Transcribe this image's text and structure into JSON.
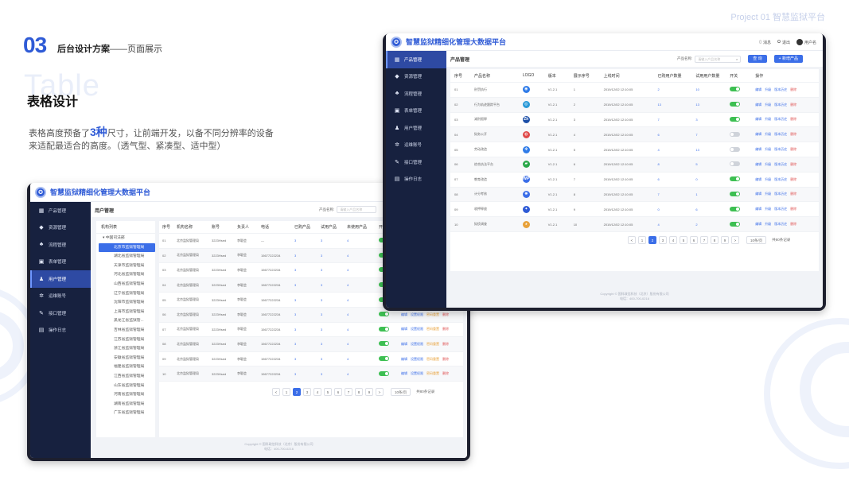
{
  "header": {
    "project_label": "Project 01  智慧监狱平台"
  },
  "section": {
    "number": "03",
    "title": "后台设计方案",
    "subtitle": "——页面展示"
  },
  "ghost_word": "Table",
  "heading": "表格设计",
  "description": {
    "before": "表格高度预备了",
    "highlight": "3种",
    "after": "尺寸，让前端开发，以备不同分辨率的设备来适配最适合的高度。（透气型、紧凑型、适中型）"
  },
  "app": {
    "title": "智慧监狱精细化管理大数据平台",
    "tools": {
      "message": "消息",
      "logout": "退出",
      "user": "用户名"
    },
    "sidebar": [
      {
        "icon": "grid-icon",
        "glyph": "▦",
        "label": "产品管理"
      },
      {
        "icon": "resource-icon",
        "glyph": "◆",
        "label": "资源管理"
      },
      {
        "icon": "flow-icon",
        "glyph": "♣",
        "label": "流程管理"
      },
      {
        "icon": "form-icon",
        "glyph": "▣",
        "label": "表单管理"
      },
      {
        "icon": "users-icon",
        "glyph": "♟",
        "label": "用户管理"
      },
      {
        "icon": "gear-icon",
        "glyph": "✲",
        "label": "运维账号"
      },
      {
        "icon": "plug-icon",
        "glyph": "✎",
        "label": "接口管理"
      },
      {
        "icon": "log-icon",
        "glyph": "▤",
        "label": "操作日志"
      }
    ],
    "footer": {
      "line1": "Copyright © 国科政信科技（北京）股份有限公司",
      "line2": "电话：400-700-0216"
    },
    "pager": {
      "prev": "<",
      "next": ">",
      "pages": [
        "1",
        "2",
        "3",
        "4",
        "5",
        "6",
        "7",
        "8",
        "9"
      ],
      "current_index": 1,
      "page_size": "10条/页",
      "total": "共80条记录"
    }
  },
  "user_page": {
    "active_sidebar": 4,
    "title": "用户管理",
    "filter_label": "产品名称:",
    "filter_placeholder": "请输入产品名称",
    "tree": {
      "header": "机构列表",
      "root": "中国司法部",
      "items": [
        "北京市监狱管理局",
        "湖北省监狱管理局",
        "天津市监狱管理局",
        "河北省监狱管理局",
        "山西省监狱管理局",
        "辽宁省监狱管理局",
        "沈阳市监狱管理局",
        "上海市监狱管理局",
        "黑龙江省监狱管...",
        "吉林省监狱管理局",
        "江苏省监狱管理局",
        "浙江省监狱管理局",
        "安徽省监狱管理局",
        "福建省监狱管理局",
        "江西省监狱管理局",
        "山东省监狱管理局",
        "河南省监狱管理局",
        "湖南省监狱管理局",
        "广东省监狱管理局"
      ],
      "selected": 0
    },
    "columns": [
      "序号",
      "机构名称",
      "账号",
      "负责人",
      "电话",
      "已购产品",
      "试用产品",
      "未使用产品",
      "开关",
      "操作"
    ],
    "ops": [
      "编辑",
      "设置权限",
      "密码重置",
      "删除"
    ],
    "rows": [
      {
        "no": "01",
        "org": "北京监狱管理局",
        "acct": "3223Hsed",
        "owner": "李聪会",
        "phone": "—",
        "bought": "3",
        "trial": "3",
        "unused": "4",
        "on": true
      },
      {
        "no": "02",
        "org": "北京监狱管理局",
        "acct": "3223Hsed",
        "owner": "李聪会",
        "phone": "15677222234",
        "bought": "3",
        "trial": "3",
        "unused": "4",
        "on": true
      },
      {
        "no": "03",
        "org": "北京监狱管理局",
        "acct": "3223Hsed",
        "owner": "李聪会",
        "phone": "15677222234",
        "bought": "3",
        "trial": "3",
        "unused": "4",
        "on": true
      },
      {
        "no": "04",
        "org": "北京监狱管理局",
        "acct": "3223Hsed",
        "owner": "李聪会",
        "phone": "15677222234",
        "bought": "3",
        "trial": "3",
        "unused": "4",
        "on": true
      },
      {
        "no": "05",
        "org": "北京监狱管理局",
        "acct": "3223Hsed",
        "owner": "李聪会",
        "phone": "15677222234",
        "bought": "3",
        "trial": "3",
        "unused": "4",
        "on": true
      },
      {
        "no": "06",
        "org": "北京监狱管理局",
        "acct": "3223Hsed",
        "owner": "李聪会",
        "phone": "15677222234",
        "bought": "3",
        "trial": "3",
        "unused": "4",
        "on": true
      },
      {
        "no": "07",
        "org": "北京监狱管理局",
        "acct": "3223Hsed",
        "owner": "李聪会",
        "phone": "15677222234",
        "bought": "3",
        "trial": "3",
        "unused": "4",
        "on": true
      },
      {
        "no": "08",
        "org": "北京监狱管理局",
        "acct": "3223Hsed",
        "owner": "李聪会",
        "phone": "15677222234",
        "bought": "3",
        "trial": "3",
        "unused": "4",
        "on": true
      },
      {
        "no": "09",
        "org": "北京监狱管理局",
        "acct": "3223Hsed",
        "owner": "李聪会",
        "phone": "15677222234",
        "bought": "3",
        "trial": "3",
        "unused": "4",
        "on": true
      },
      {
        "no": "10",
        "org": "北京监狱管理局",
        "acct": "3223Hsed",
        "owner": "李聪会",
        "phone": "15677222234",
        "bought": "3",
        "trial": "3",
        "unused": "4",
        "on": true
      }
    ]
  },
  "product_page": {
    "active_sidebar": 0,
    "title": "产品管理",
    "filter_label": "产品名称:",
    "filter_placeholder": "请输入产品名称",
    "query_button": "查 询",
    "add_button": "+ 新增产品",
    "columns": [
      "序号",
      "产品名称",
      "LOGO",
      "版本",
      "展示序号",
      "上线时间",
      "已购用户数量",
      "试用用户数量",
      "开关",
      "操作"
    ],
    "ops": [
      "编辑",
      "升级",
      "版本历史",
      "删除"
    ],
    "rows": [
      {
        "no": "01",
        "name": "刑罚执行",
        "logo": "cloud-logo",
        "color": "#2f7be8",
        "glyph": "◉",
        "ver": "V1.2.1",
        "order": "1",
        "time": "2019/12/02  12:10:05",
        "bought": "2",
        "trial": "10",
        "on": true
      },
      {
        "no": "02",
        "name": "行为轨迹跟踪平台",
        "logo": "ring-logo",
        "color": "#2a9ad8",
        "glyph": "◎",
        "ver": "V1.2.1",
        "order": "2",
        "time": "2019/12/02  12:10:05",
        "bought": "13",
        "trial": "13",
        "on": true
      },
      {
        "no": "03",
        "name": "减刑假释",
        "logo": "zh-logo",
        "color": "#1d4fa8",
        "glyph": "Zh",
        "ver": "V1.2.1",
        "order": "3",
        "time": "2019/12/02  12:10:05",
        "bought": "7",
        "trial": "3",
        "on": true
      },
      {
        "no": "04",
        "name": "狱务公开",
        "logo": "circle-logo",
        "color": "#e04a4a",
        "glyph": "◍",
        "ver": "V1.2.1",
        "order": "4",
        "time": "2019/12/02  12:10:05",
        "bought": "6",
        "trial": "7",
        "on": false
      },
      {
        "no": "05",
        "name": "劳动改造",
        "logo": "gear-logo",
        "color": "#2f7be8",
        "glyph": "✻",
        "ver": "V1.2.1",
        "order": "5",
        "time": "2019/12/02  12:10:05",
        "bought": "4",
        "trial": "13",
        "on": false
      },
      {
        "no": "06",
        "name": "综合执法平台",
        "logo": "flag-logo",
        "color": "#2aa84a",
        "glyph": "▰",
        "ver": "V1.2.1",
        "order": "6",
        "time": "2019/12/02  12:10:05",
        "bought": "8",
        "trial": "5",
        "on": false
      },
      {
        "no": "07",
        "name": "教育改造",
        "logo": "wp-logo",
        "color": "#3b6ee8",
        "glyph": "WP",
        "ver": "V1.2.1",
        "order": "7",
        "time": "2019/12/02  12:10:05",
        "bought": "6",
        "trial": "0",
        "on": true
      },
      {
        "no": "08",
        "name": "计分考核",
        "logo": "swirl-logo",
        "color": "#3b6ee8",
        "glyph": "✺",
        "ver": "V1.2.1",
        "order": "8",
        "time": "2019/12/02  12:10:05",
        "bought": "7",
        "trial": "1",
        "on": true
      },
      {
        "no": "09",
        "name": "收押释放",
        "logo": "bird-logo",
        "color": "#2f5bd6",
        "glyph": "✦",
        "ver": "V1.2.1",
        "order": "9",
        "time": "2019/12/02  12:10:05",
        "bought": "0",
        "trial": "6",
        "on": true
      },
      {
        "no": "10",
        "name": "狱侦调查",
        "logo": "chrome-logo",
        "color": "#e8a23b",
        "glyph": "◕",
        "ver": "V1.2.1",
        "order": "10",
        "time": "2019/12/02  12:10:05",
        "bought": "4",
        "trial": "2",
        "on": true
      }
    ]
  }
}
